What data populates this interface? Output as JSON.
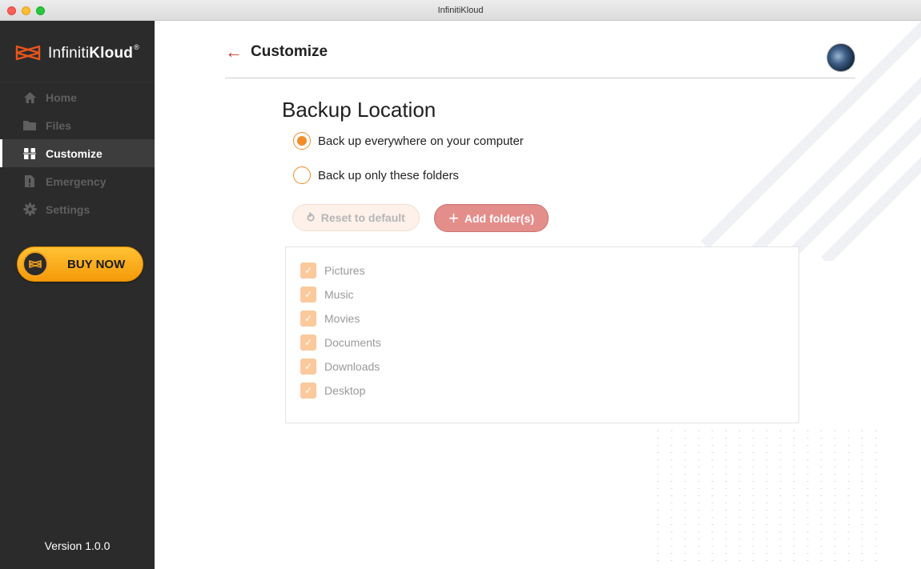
{
  "window": {
    "title": "InfinitiKloud"
  },
  "sidebar": {
    "logo": {
      "light": "Infiniti",
      "bold": "Kloud",
      "mark": "®"
    },
    "items": [
      {
        "label": "Home",
        "icon": "home-icon",
        "active": false
      },
      {
        "label": "Files",
        "icon": "folder-icon",
        "active": false
      },
      {
        "label": "Customize",
        "icon": "customize-icon",
        "active": true
      },
      {
        "label": "Emergency",
        "icon": "emergency-icon",
        "active": false
      },
      {
        "label": "Settings",
        "icon": "gear-icon",
        "active": false
      }
    ],
    "buy_now": "BUY NOW",
    "version": "Version 1.0.0"
  },
  "header": {
    "title": "Customize"
  },
  "backup": {
    "title": "Backup Location",
    "options": [
      {
        "label": "Back up everywhere on your computer",
        "checked": true
      },
      {
        "label": "Back up only these folders",
        "checked": false
      }
    ],
    "reset_label": "Reset to default",
    "add_label": "Add folder(s)",
    "folders": [
      {
        "label": "Pictures",
        "checked": true
      },
      {
        "label": "Music",
        "checked": true
      },
      {
        "label": "Movies",
        "checked": true
      },
      {
        "label": "Documents",
        "checked": true
      },
      {
        "label": "Downloads",
        "checked": true
      },
      {
        "label": "Desktop",
        "checked": true
      }
    ]
  },
  "colors": {
    "sidebar": "#2b2b2b",
    "accent": "#f28c28",
    "add_button": "#e48e8c",
    "back_arrow": "#c0392b"
  }
}
